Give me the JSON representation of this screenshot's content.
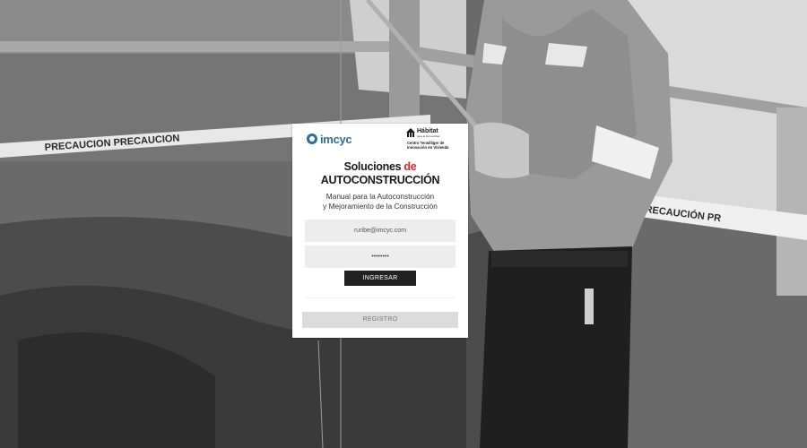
{
  "background": {
    "description_icon": "construction-site-photo",
    "tape_text_left": "PRECAUCION   PRECAUCION",
    "tape_text_right": "PRECAUCIÓN   PR"
  },
  "logos": {
    "imcyc": "imcyc",
    "habitat_name": "Hábitat",
    "habitat_sub": "para la Humanidad",
    "habitat_center_line1": "Centro Terwilliger de",
    "habitat_center_line2": "Innovación en Vivienda"
  },
  "title": {
    "line1_prefix": "Soluciones ",
    "line1_accent": "de",
    "line2": "AUTOCONSTRUCCIÓN",
    "accent_color": "#e2202e"
  },
  "subtitle": {
    "line1": "Manual para la Autoconstrucción",
    "line2": "y Mejoramiento de la Construcción"
  },
  "form": {
    "email_value": "ruribe@imcyc.com",
    "password_value": "••••••••"
  },
  "buttons": {
    "login": "INGRESAR",
    "register": "REGISTRO"
  }
}
